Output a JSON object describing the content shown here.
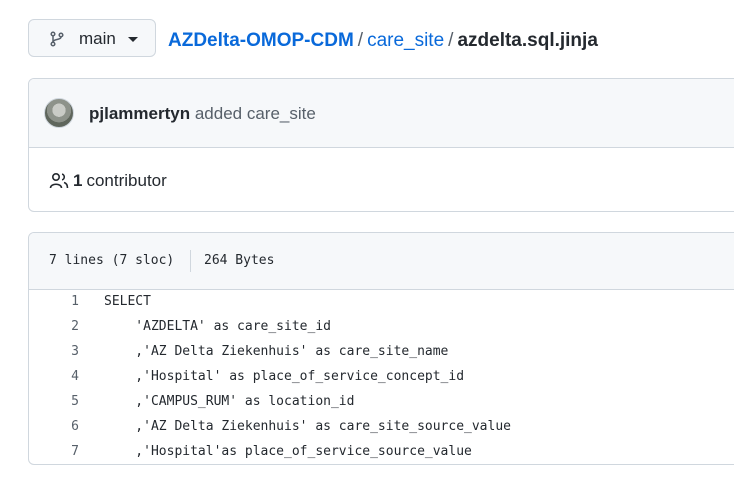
{
  "header": {
    "branch_label": "main",
    "breadcrumb": {
      "repo": "AZDelta-OMOP-CDM",
      "sep1": "/",
      "dir": "care_site",
      "sep2": "/",
      "file": "azdelta.sql.jinja"
    }
  },
  "commit": {
    "author": "pjlammertyn",
    "message": "added care_site",
    "contributor_count": "1",
    "contributor_label": "contributor"
  },
  "file": {
    "lines_info": "7 lines (7 sloc)",
    "size": "264 Bytes",
    "code_lines": [
      {
        "num": "1",
        "text": "SELECT"
      },
      {
        "num": "2",
        "text": "    'AZDELTA' as care_site_id"
      },
      {
        "num": "3",
        "text": "    ,'AZ Delta Ziekenhuis' as care_site_name"
      },
      {
        "num": "4",
        "text": "    ,'Hospital' as place_of_service_concept_id"
      },
      {
        "num": "5",
        "text": "    ,'CAMPUS_RUM' as location_id"
      },
      {
        "num": "6",
        "text": "    ,'AZ Delta Ziekenhuis' as care_site_source_value"
      },
      {
        "num": "7",
        "text": "    ,'Hospital'as place_of_service_source_value"
      }
    ]
  },
  "icons": {
    "branch": "git-branch-icon",
    "caret": "caret-down-icon",
    "avatar": "user-avatar",
    "contributors": "people-icon"
  }
}
